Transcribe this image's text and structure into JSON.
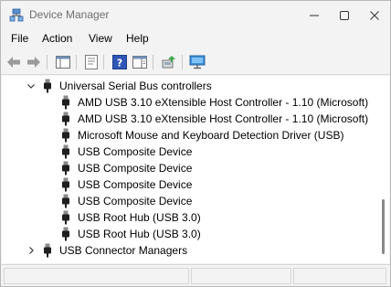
{
  "window": {
    "title": "Device Manager",
    "icon": "device-manager-icon",
    "controls": [
      "minimize-icon",
      "maximize-icon",
      "close-icon"
    ]
  },
  "menu": {
    "items": [
      "File",
      "Action",
      "View",
      "Help"
    ]
  },
  "toolbar": {
    "buttons": [
      "back-icon",
      "forward-icon",
      "show-hide-console-tree-icon",
      "properties-icon",
      "help-icon",
      "action-pane-icon",
      "update-driver-icon",
      "scan-hardware-icon"
    ]
  },
  "tree": {
    "category": {
      "label": "Universal Serial Bus controllers",
      "expanded": true
    },
    "devices": [
      "AMD USB 3.10 eXtensible Host Controller - 1.10 (Microsoft)",
      "AMD USB 3.10 eXtensible Host Controller - 1.10 (Microsoft)",
      "Microsoft Mouse and Keyboard Detection Driver (USB)",
      "USB Composite Device",
      "USB Composite Device",
      "USB Composite Device",
      "USB Composite Device",
      "USB Root Hub (USB 3.0)",
      "USB Root Hub (USB 3.0)"
    ],
    "next_category": {
      "label": "USB Connector Managers",
      "expanded": false
    }
  },
  "colors": {
    "window_bg": "#f3f3f3",
    "tree_bg": "#ffffff",
    "title_text": "#6e6e6e"
  }
}
